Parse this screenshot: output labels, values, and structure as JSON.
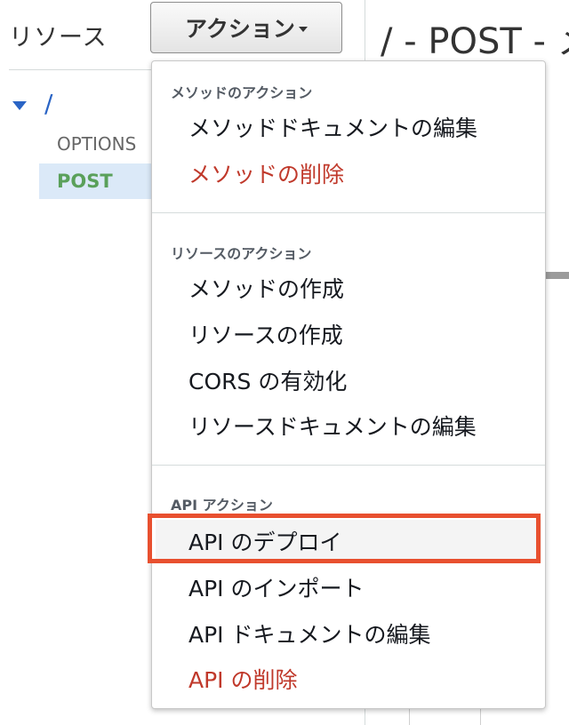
{
  "resources_panel": {
    "title": "リソース",
    "root_path": "/",
    "methods": [
      {
        "label": "OPTIONS",
        "selected": false
      },
      {
        "label": "POST",
        "selected": true
      }
    ]
  },
  "actions_button": {
    "label": "アクション"
  },
  "main": {
    "title": "/ - POST - メ"
  },
  "dropdown": {
    "sections": [
      {
        "header": "メソッドのアクション",
        "items": [
          {
            "label": "メソッドドキュメントの編集",
            "danger": false
          },
          {
            "label": "メソッドの削除",
            "danger": true
          }
        ]
      },
      {
        "header": "リソースのアクション",
        "items": [
          {
            "label": "メソッドの作成",
            "danger": false
          },
          {
            "label": "リソースの作成",
            "danger": false
          },
          {
            "label": "CORS の有効化",
            "danger": false
          },
          {
            "label": "リソースドキュメントの編集",
            "danger": false
          }
        ]
      },
      {
        "header": "API アクション",
        "items": [
          {
            "label": "API のデプロイ",
            "danger": false,
            "highlighted": true
          },
          {
            "label": "API のインポート",
            "danger": false
          },
          {
            "label": "API ドキュメントの編集",
            "danger": false
          },
          {
            "label": "API の削除",
            "danger": true
          }
        ]
      }
    ]
  },
  "colors": {
    "link_blue": "#2a64c5",
    "post_green": "#5aa05a",
    "danger_red": "#c0392b",
    "highlight_orange": "#e8502f",
    "selected_bg": "#dbe9f8"
  }
}
